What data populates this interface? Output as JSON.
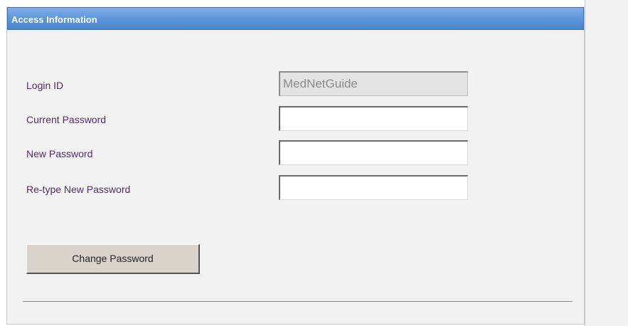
{
  "panel": {
    "title": "Access Information"
  },
  "form": {
    "login_id": {
      "label": "Login ID",
      "value": "MedNetGuide"
    },
    "current_password": {
      "label": "Current Password",
      "value": ""
    },
    "new_password": {
      "label": "New Password",
      "value": ""
    },
    "retype_password": {
      "label": "Re-type New Password",
      "value": ""
    },
    "submit_label": "Change Password"
  },
  "colors": {
    "header_blue": "#5e96d8",
    "label_purple": "#4b2e63",
    "panel_bg": "#f2f2f2"
  }
}
